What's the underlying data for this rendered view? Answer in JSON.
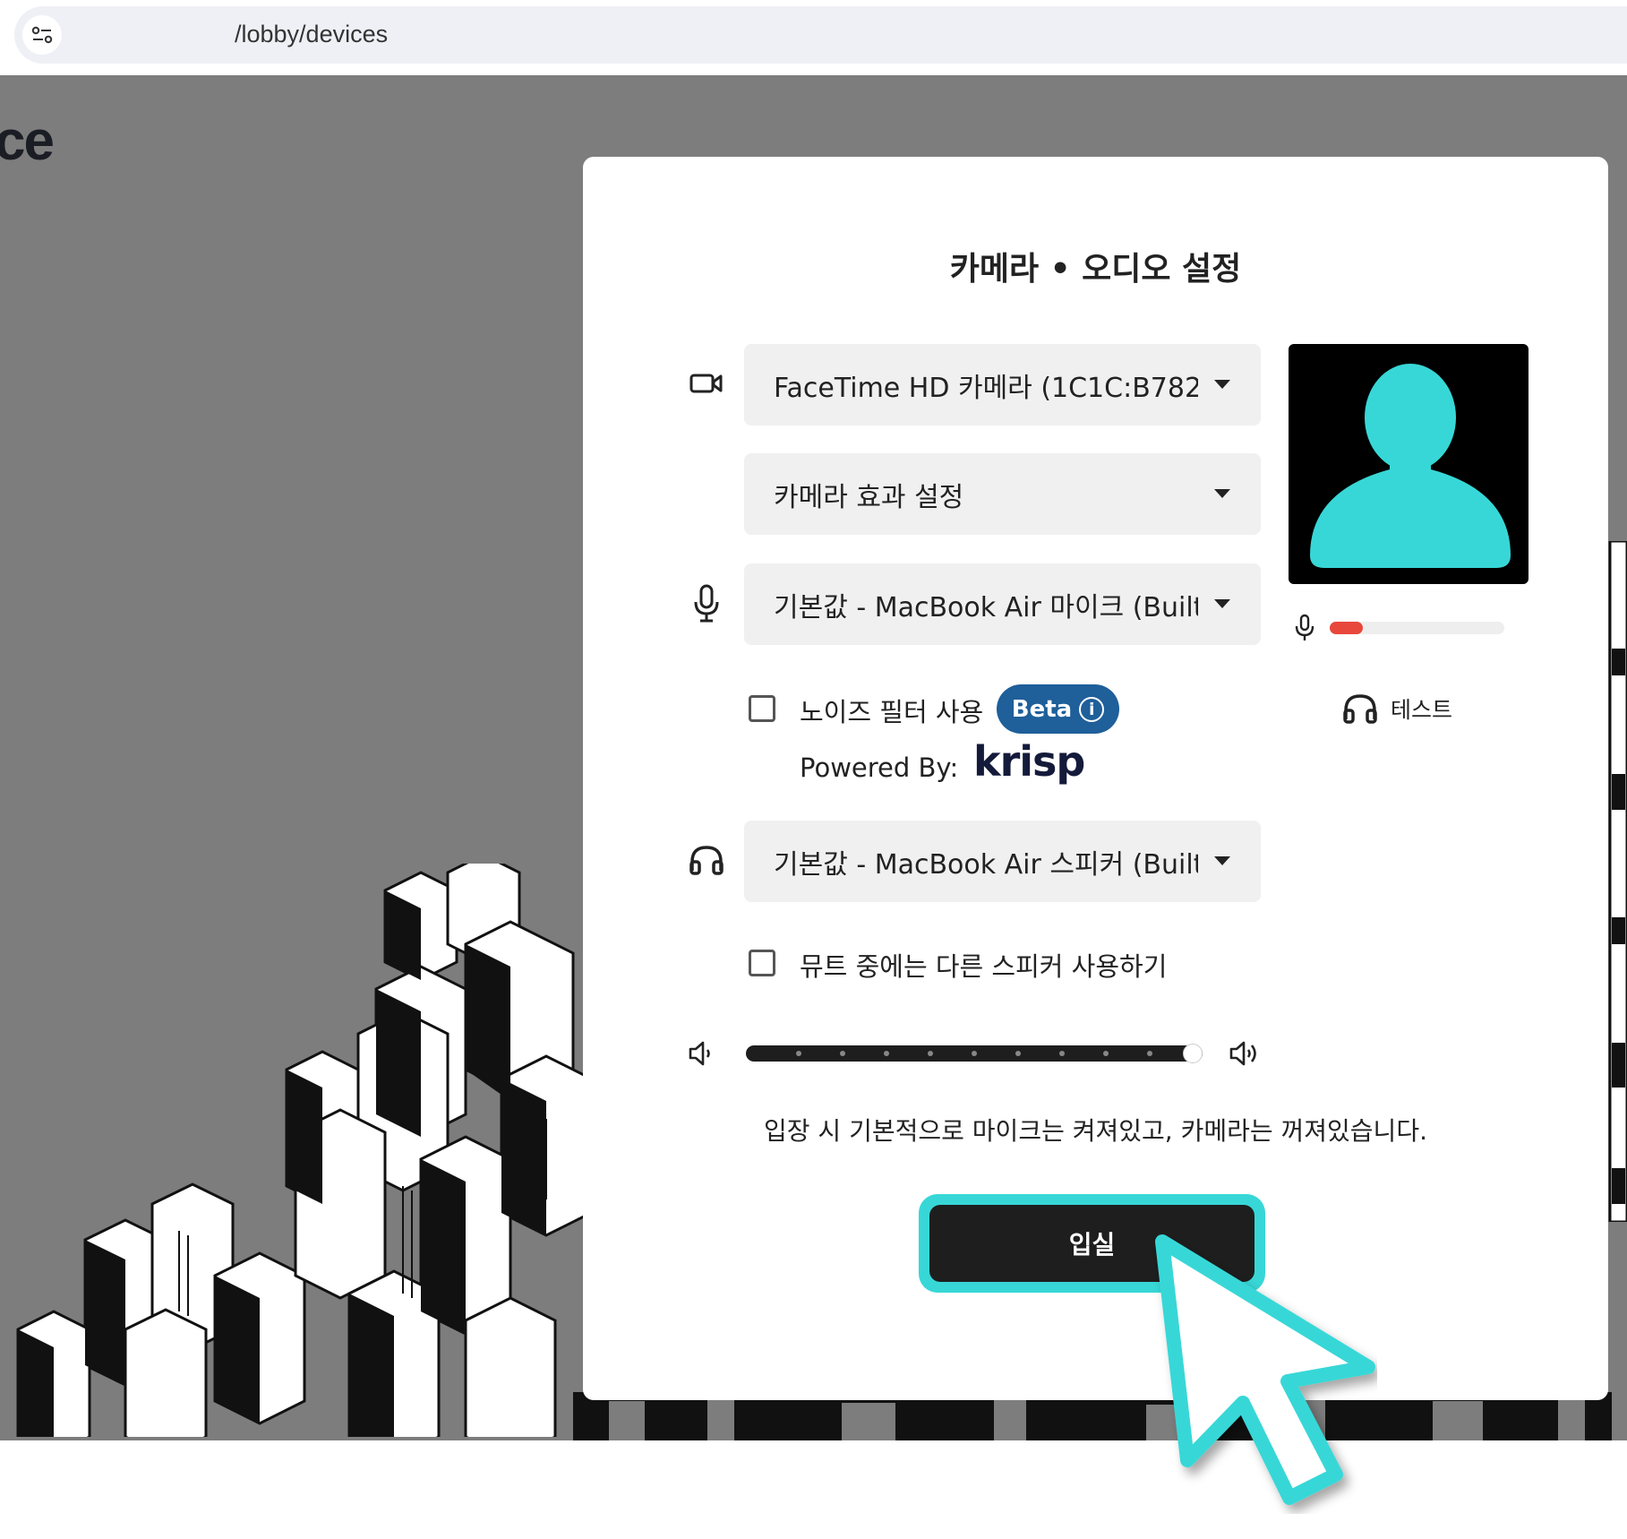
{
  "browser": {
    "url": "/lobby/devices"
  },
  "background": {
    "logo_fragment": "ce"
  },
  "modal": {
    "title": "카메라 • 오디오 설정",
    "camera_select": {
      "value": "FaceTime HD 카메라 (1C1C:B782)"
    },
    "camera_effect_select": {
      "value": "카메라 효과 설정"
    },
    "mic_select": {
      "value": "기본값 - MacBook Air 마이크 (Built..."
    },
    "noise_filter": {
      "label": "노이즈 필터 사용",
      "checked": false,
      "badge": "Beta",
      "info_icon": "i"
    },
    "powered_by": {
      "label": "Powered By:",
      "brand": "krisp"
    },
    "speaker_select": {
      "value": "기본값 - MacBook Air 스피커 (Built..."
    },
    "mute_speaker": {
      "label": "뮤트 중에는 다른 스피커 사용하기",
      "checked": false
    },
    "preview": {
      "icon": "avatar-silhouette",
      "color": "#38d7d7"
    },
    "mic_level": {
      "fraction": 0.19,
      "color": "#e8473b"
    },
    "test_button": {
      "label": "테스트",
      "icon": "headphones-icon"
    },
    "volume": {
      "fraction": 1.0,
      "steps": 10
    },
    "notice": "입장 시 기본적으로 마이크는 켜져있고, 카메라는 꺼져있습니다.",
    "enter_button": {
      "label": "입실",
      "highlight_color": "#38d7d7"
    }
  }
}
